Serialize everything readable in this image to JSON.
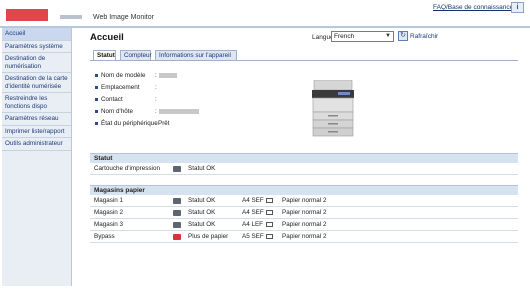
{
  "header": {
    "app_title": "Web Image Monitor",
    "faq_link": "FAQ/Base de connaissances",
    "help_icon": "i",
    "logo": "logo",
    "colors": {
      "brand_red": "#e4454c",
      "link_blue": "#1b3a7a",
      "sidebar_bg": "#e9eef5"
    }
  },
  "sidebar": {
    "items": [
      {
        "label": "Accueil"
      },
      {
        "label": "Paramètres système"
      },
      {
        "label": "Destination de numérisation"
      },
      {
        "label": "Destination de la carte d'identité numérisée"
      },
      {
        "label": "Restreindre les fonctions dispo"
      },
      {
        "label": "Paramètres réseau"
      },
      {
        "label": "Imprimer liste/rapport"
      },
      {
        "label": "Outils administrateur"
      }
    ]
  },
  "main": {
    "title": "Accueil",
    "language_label": "Langue",
    "language_value": "French",
    "refresh_label": "Rafraîchir",
    "tabs": [
      {
        "label": "Statut"
      },
      {
        "label": "Compteur"
      },
      {
        "label": "Informations sur l'appareil"
      }
    ],
    "device_info": [
      {
        "label": "Nom de modèle",
        "value": ""
      },
      {
        "label": "Emplacement",
        "value": ""
      },
      {
        "label": "Contact",
        "value": ""
      },
      {
        "label": "Nom d'hôte",
        "value": ""
      },
      {
        "label": "État du périphérique",
        "value": "Prêt"
      }
    ],
    "status_section": {
      "heading": "Statut",
      "rows": [
        {
          "name": "Cartouche d'impression",
          "status": "Statut OK"
        }
      ]
    },
    "paper_section": {
      "heading": "Magasins papier",
      "rows": [
        {
          "name": "Magasin 1",
          "status": "Statut OK",
          "size": "A4 SEF",
          "type": "Papier normal 2",
          "icon": "tray-ok-icon"
        },
        {
          "name": "Magasin 2",
          "status": "Statut OK",
          "size": "A4 SEF",
          "type": "Papier normal 2",
          "icon": "tray-ok-icon"
        },
        {
          "name": "Magasin 3",
          "status": "Statut OK",
          "size": "A4 LEF",
          "type": "Papier normal 2",
          "icon": "tray-ok-icon"
        },
        {
          "name": "Bypass",
          "status": "Plus de papier",
          "size": "A5 SEF",
          "type": "Papier normal 2",
          "icon": "tray-empty-icon"
        }
      ]
    }
  }
}
